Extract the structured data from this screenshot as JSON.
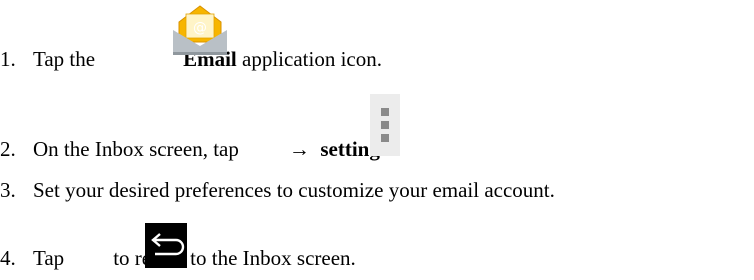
{
  "steps": [
    {
      "number": "1.",
      "before": "Tap the",
      "icon": "email-app-icon",
      "bold": "Email",
      "after": "application icon."
    },
    {
      "number": "2.",
      "before": "On the Inbox screen, tap",
      "icon": "overflow-menu-icon",
      "arrow": "→",
      "bold": "settings",
      "after": "."
    },
    {
      "number": "3.",
      "text": "Set your desired preferences to customize your email account."
    },
    {
      "number": "4.",
      "before": "Tap",
      "icon": "back-icon",
      "after": "to return to the Inbox screen."
    }
  ],
  "icons": {
    "email_badge": "@"
  },
  "colors": {
    "email_envelope": "#f7b500",
    "email_tray": "#9aa3aa",
    "menu_bg": "#e7e7e7",
    "menu_square": "#8a8a8a",
    "back_bg": "#000000",
    "back_arrow": "#ffffff"
  }
}
